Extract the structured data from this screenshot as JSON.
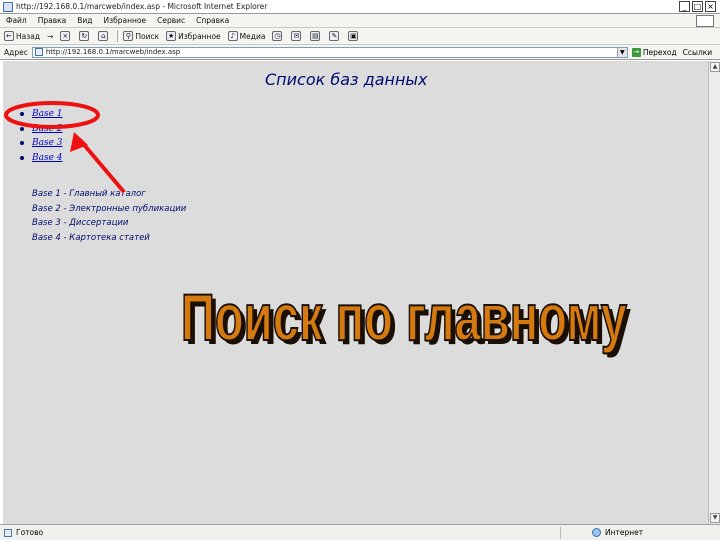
{
  "window": {
    "title": "http://192.168.0.1/marcweb/index.asp - Microsoft Internet Explorer",
    "controls": [
      "_",
      "□",
      "×"
    ]
  },
  "menu": {
    "items": [
      "Файл",
      "Правка",
      "Вид",
      "Избранное",
      "Сервис",
      "Справка"
    ]
  },
  "toolbar": {
    "back": "Назад",
    "forward": "→",
    "search": "Поиск",
    "favorites": "Избранное",
    "media": "Медиа"
  },
  "address": {
    "label": "Адрес",
    "value": "http://192.168.0.1/marcweb/index.asp",
    "go": "Переход",
    "links": "Ссылки"
  },
  "page": {
    "heading": "Список баз данных",
    "databases": [
      "Base 1",
      "Base 2",
      "Base 3",
      "Base 4"
    ],
    "descriptions": [
      "Base 1 - Главный каталог",
      "Base 2 - Электронные публикации",
      "Base 3 - Диссертации",
      "Base 4 - Картотека статей"
    ]
  },
  "overlay": {
    "caption": "Поиск по главному",
    "caption_fill": "#d47a10",
    "caption_outline": "#1a0f05",
    "highlight_color": "#ee1111"
  },
  "status": {
    "left": "Готово",
    "zone": "Интернет"
  },
  "colors": {
    "content_bg": "#dcdcdc",
    "heading": "#000a6e",
    "link": "#0000cc"
  }
}
